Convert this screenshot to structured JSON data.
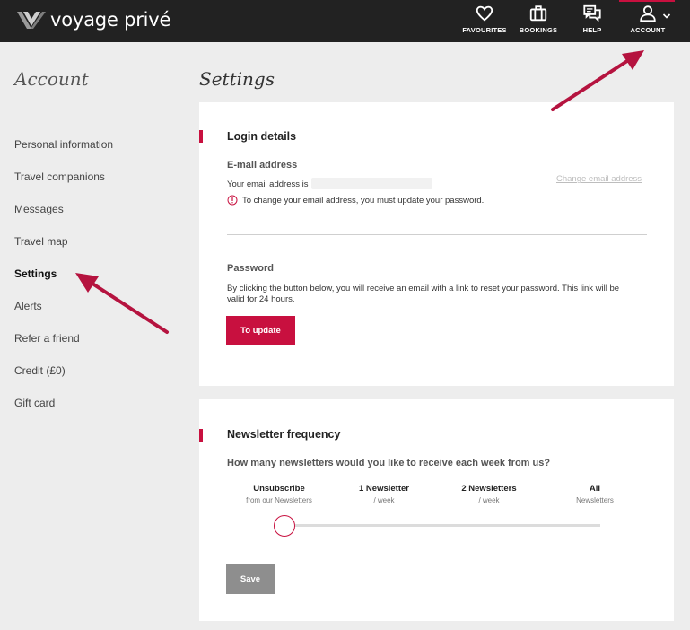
{
  "header": {
    "brand": "voyage privé",
    "nav": [
      {
        "label": "FAVOURITES",
        "icon": "heart-icon"
      },
      {
        "label": "BOOKINGS",
        "icon": "suitcase-icon"
      },
      {
        "label": "HELP",
        "icon": "chat-bubbles-icon"
      },
      {
        "label": "ACCOUNT",
        "icon": "user-icon"
      }
    ]
  },
  "sidebar": {
    "title": "Account",
    "items": [
      {
        "label": "Personal information"
      },
      {
        "label": "Travel companions"
      },
      {
        "label": "Messages"
      },
      {
        "label": "Travel map"
      },
      {
        "label": "Settings",
        "active": true
      },
      {
        "label": "Alerts"
      },
      {
        "label": "Refer a friend"
      },
      {
        "label": "Credit (£0)"
      },
      {
        "label": "Gift card"
      }
    ]
  },
  "main": {
    "title": "Settings",
    "login": {
      "heading": "Login details",
      "email_heading": "E-mail address",
      "email_text": "Your email address is",
      "change_email": "Change email address",
      "warning": "To change your email address, you must update your password.",
      "password_heading": "Password",
      "password_text_1": "By clicking the button below, you will receive an email with a link to reset your password. This link will be",
      "password_text_2": "valid for 24 hours.",
      "update_button": "To update"
    },
    "newsletter": {
      "heading": "Newsletter frequency",
      "question": "How many newsletters would you like to receive each week from us?",
      "options": [
        {
          "label": "Unsubscribe",
          "sub": "from our Newsletters"
        },
        {
          "label": "1 Newsletter",
          "sub": "/ week"
        },
        {
          "label": "2 Newsletters",
          "sub": "/ week"
        },
        {
          "label": "All",
          "sub": "Newsletters"
        }
      ],
      "selected_index": 0,
      "save_button": "Save"
    }
  },
  "colors": {
    "accent": "#c8103f",
    "header_bg": "#222222",
    "page_bg": "#ededed",
    "save_disabled": "#8e8e8e"
  }
}
